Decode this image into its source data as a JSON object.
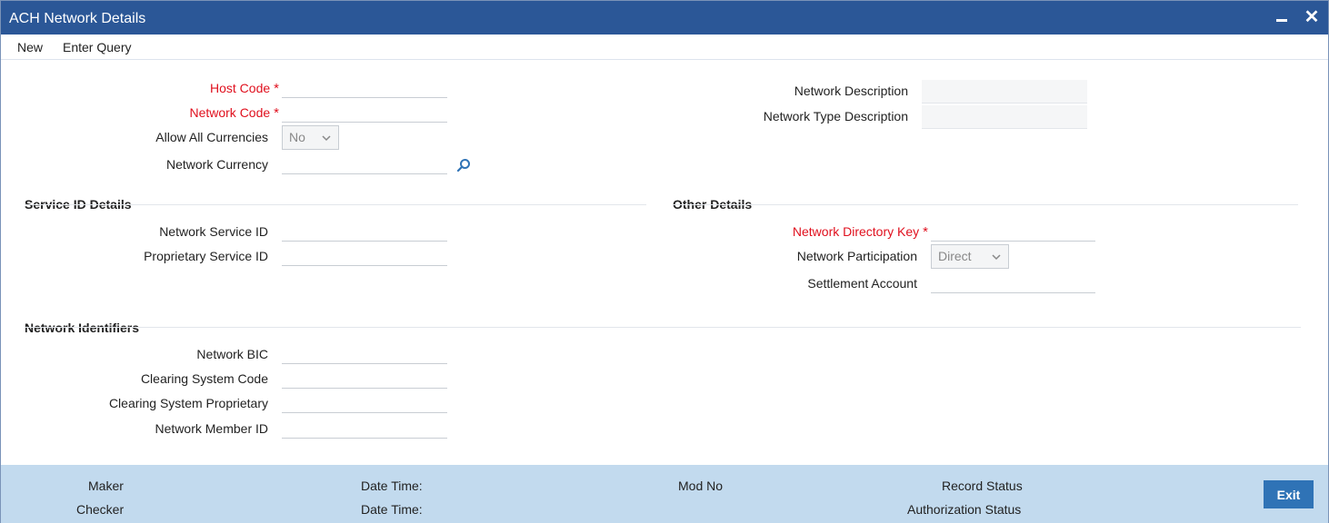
{
  "window": {
    "title": "ACH Network Details",
    "minimize_icon": "minimize-icon",
    "close_icon": "close-icon",
    "close_glyph": "✕"
  },
  "menu": {
    "new_label": "New",
    "enter_query_label": "Enter Query"
  },
  "main": {
    "host_code_label": "Host Code",
    "network_code_label": "Network Code",
    "allow_all_currencies_label": "Allow All Currencies",
    "allow_all_currencies_value": "No",
    "network_currency_label": "Network Currency",
    "network_description_label": "Network Description",
    "network_type_description_label": "Network Type Description",
    "required_mark": "*"
  },
  "service_id": {
    "section_title": "Service ID Details",
    "network_service_id_label": "Network Service ID",
    "proprietary_service_id_label": "Proprietary Service ID"
  },
  "other_details": {
    "section_title": "Other Details",
    "network_directory_key_label": "Network Directory Key",
    "network_participation_label": "Network Participation",
    "network_participation_value": "Direct",
    "settlement_account_label": "Settlement Account"
  },
  "network_identifiers": {
    "section_title": "Network Identifiers",
    "network_bic_label": "Network BIC",
    "clearing_system_code_label": "Clearing System Code",
    "clearing_system_proprietary_label": "Clearing System Proprietary",
    "network_member_id_label": "Network Member ID"
  },
  "footer": {
    "maker_label": "Maker",
    "checker_label": "Checker",
    "date_time_label_1": "Date Time:",
    "date_time_label_2": "Date Time:",
    "mod_no_label": "Mod No",
    "record_status_label": "Record Status",
    "authorization_status_label": "Authorization Status",
    "exit_label": "Exit"
  },
  "colors": {
    "titlebar": "#2b5797",
    "required_text": "#e0101e",
    "footer_bg": "#c2daee",
    "exit_button": "#2f73b6",
    "search_icon": "#2f73b6"
  }
}
